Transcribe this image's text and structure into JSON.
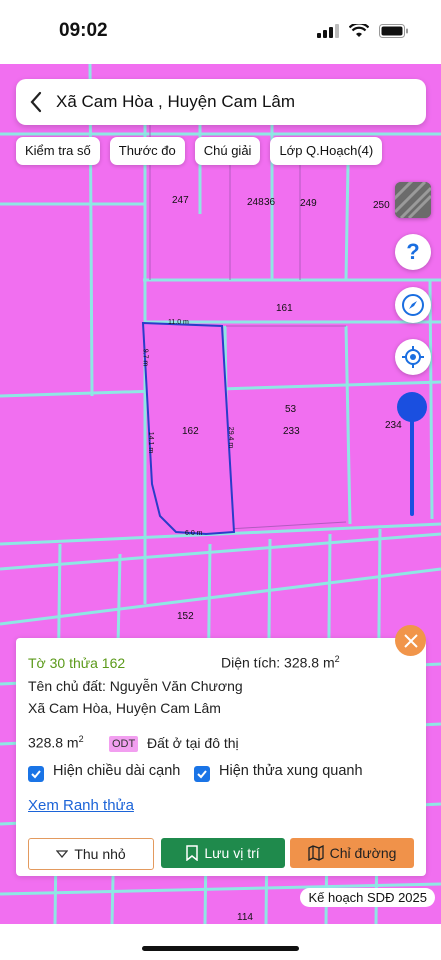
{
  "status": {
    "time": "09:02"
  },
  "header": {
    "title": "Xã Cam Hòa , Huyện Cam Lâm"
  },
  "chips": [
    "Kiểm tra số",
    "Thước đo",
    "Chú giải",
    "Lớp Q.Hoạch(4)"
  ],
  "map": {
    "parcel_numbers": [
      "247",
      "248",
      "36",
      "249",
      "250",
      "161",
      "53",
      "162",
      "233",
      "234",
      "152",
      "114"
    ],
    "edge_lengths": [
      "11.0 m",
      "9.7 m",
      "14.1 m",
      "29.4 m",
      "6.0 m"
    ],
    "land_color": "#f16ff0",
    "road_color": "#8fe7e4",
    "highlight_color": "#2a3cc9"
  },
  "card": {
    "parcel_ref": "Tờ 30 thửa 162",
    "area_label": "Diện tích: 328.8 m",
    "area_sup": "2",
    "owner": "Tên chủ đất: Nguyễn Văn Chương",
    "address": "Xã Cam Hòa, Huyện Cam Lâm",
    "area_value": "328.8 m",
    "land_code": "ODT",
    "land_type": "Đất ở tại đô thị",
    "checkbox_edges": "Hiện chiều dài cạnh",
    "checkbox_neighbors": "Hiện thửa xung quanh",
    "link": "Xem Ranh thửa",
    "btn_shrink": "Thu nhỏ",
    "btn_save": "Lưu vị trí",
    "btn_directions": "Chỉ đường"
  },
  "plan_label": "Kế hoạch SDĐ 2025",
  "colors": {
    "accent_blue": "#1a4fe0",
    "orange": "#f1954a",
    "green_btn": "#1f8a4c",
    "directions": "#f0924a"
  }
}
